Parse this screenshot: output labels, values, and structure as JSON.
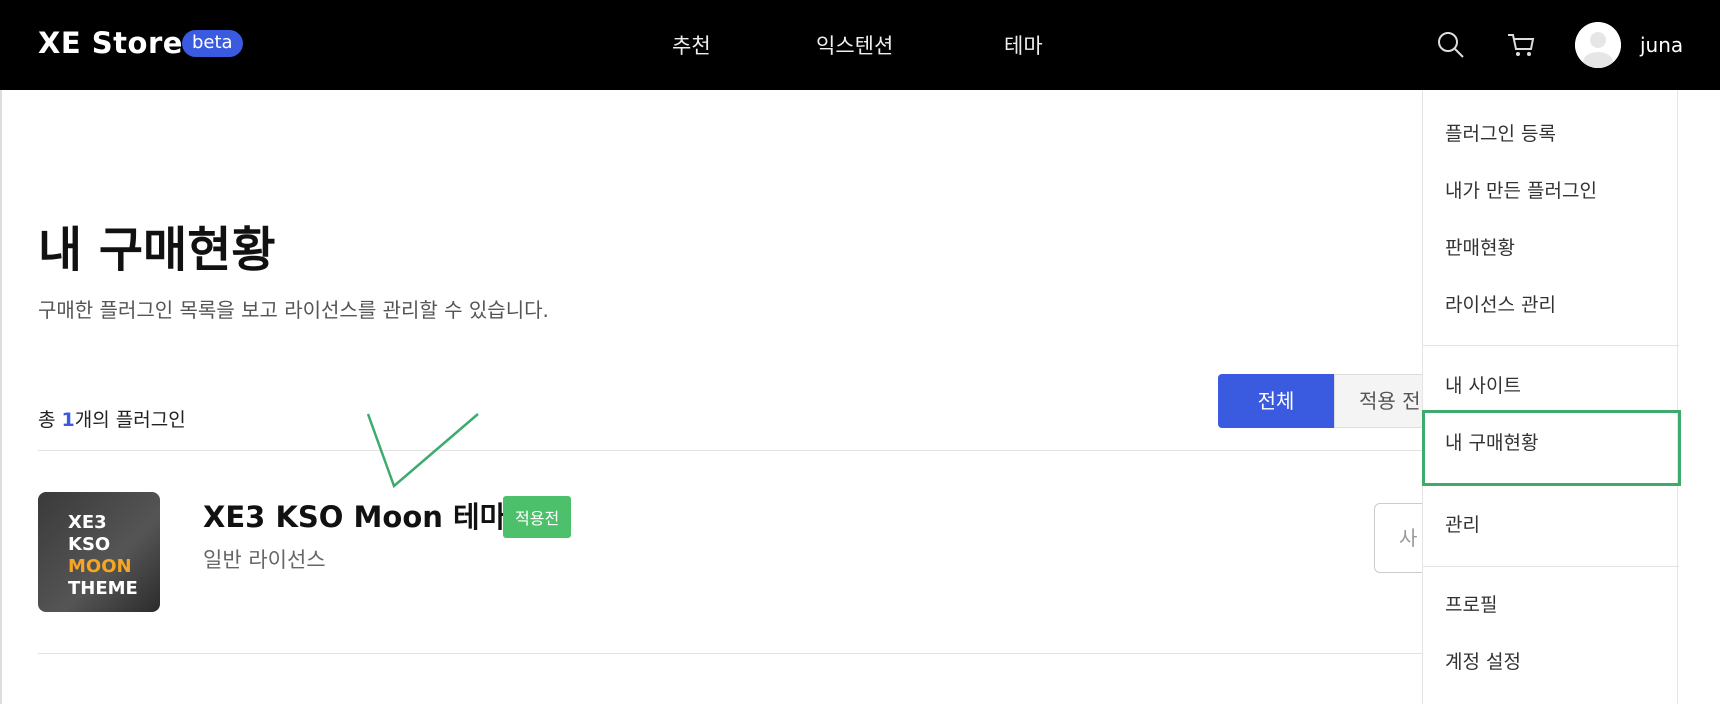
{
  "header": {
    "logo": "XE Store",
    "badge": "beta",
    "nav": [
      "추천",
      "익스텐션",
      "테마"
    ],
    "username": "juna"
  },
  "main": {
    "title": "내 구매현황",
    "description": "구매한 플러그인 목록을 보고 라이선스를 관리할 수 있습니다.",
    "count_prefix": "총 ",
    "count": "1",
    "count_suffix": "개의 플러그인",
    "filters": [
      "전체",
      "적용 전"
    ],
    "items": [
      {
        "thumb_lines": [
          "XE3",
          "KSO",
          "MOON",
          "THEME"
        ],
        "title": "XE3 KSO Moon 테마",
        "badge": "적용전",
        "license": "일반 라이선스",
        "action": "사"
      }
    ]
  },
  "dropdown": {
    "items": [
      "플러그인 등록",
      "내가 만든 플러그인",
      "판매현황",
      "라이선스 관리",
      "내 사이트",
      "내 구매현황",
      "관리",
      "프로필",
      "계정 설정"
    ]
  },
  "colors": {
    "accent": "#3a5be0",
    "badge_green": "#4cc06a",
    "highlight_green": "#3dab6e",
    "topbar": "#000000"
  },
  "icons": [
    "search-icon",
    "cart-icon",
    "avatar-icon",
    "check-icon"
  ]
}
